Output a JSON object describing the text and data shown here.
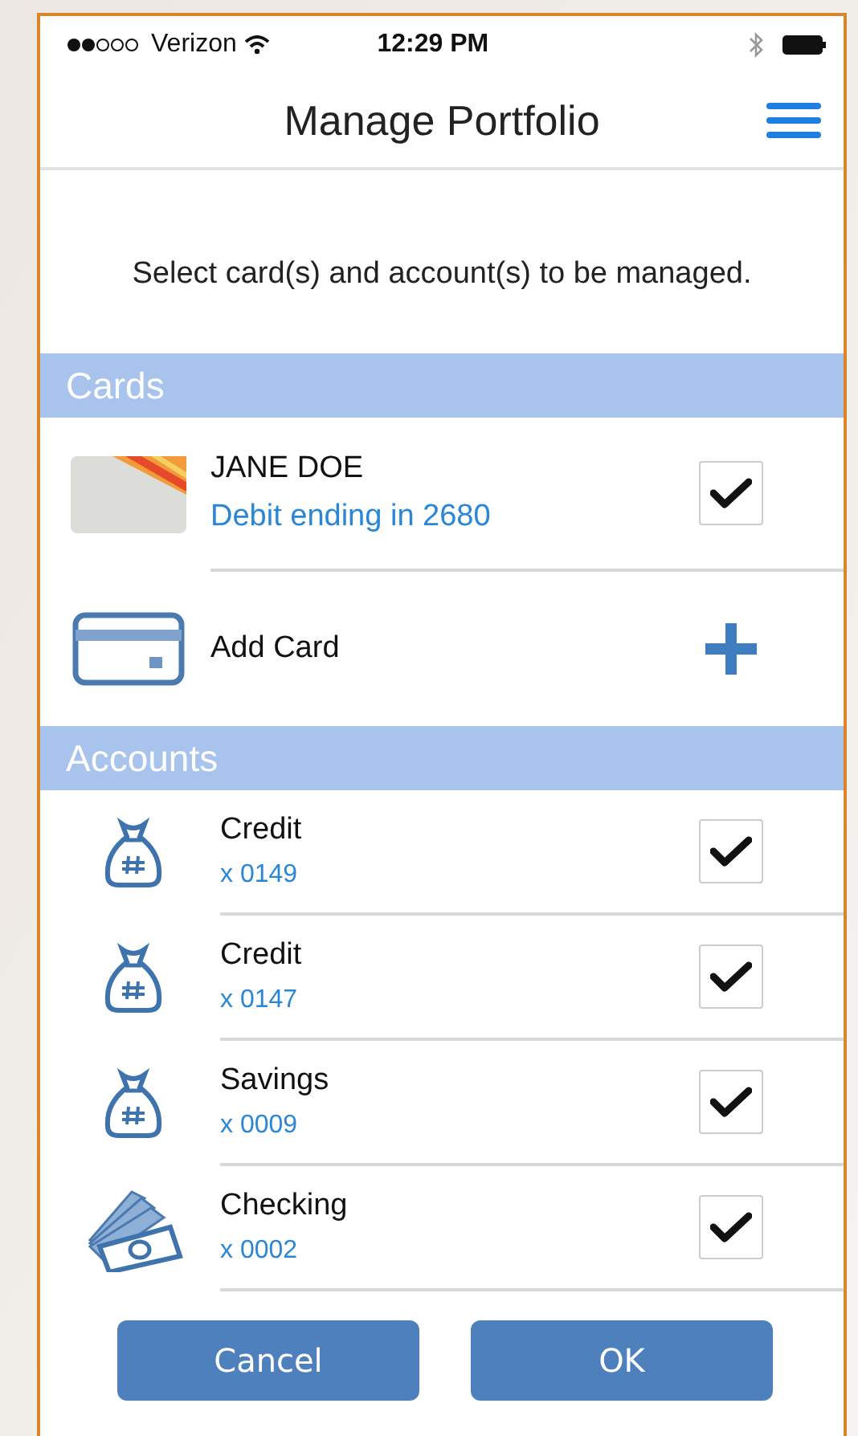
{
  "status_bar": {
    "carrier": "Verizon",
    "time": "12:29 PM"
  },
  "nav": {
    "title": "Manage Portfolio"
  },
  "instruction": "Select card(s) and account(s) to be managed.",
  "cards_section": {
    "title": "Cards",
    "cards": [
      {
        "name": "JANE DOE",
        "detail": "Debit ending in 2680",
        "checked": true
      }
    ],
    "add_label": "Add Card"
  },
  "accounts_section": {
    "title": "Accounts",
    "accounts": [
      {
        "kind": "bag",
        "name": "Credit",
        "number": "x 0149",
        "checked": true
      },
      {
        "kind": "bag",
        "name": "Credit",
        "number": "x 0147",
        "checked": true
      },
      {
        "kind": "bag",
        "name": "Savings",
        "number": "x 0009",
        "checked": true
      },
      {
        "kind": "cash",
        "name": "Checking",
        "number": "x 0002",
        "checked": true
      }
    ]
  },
  "buttons": [
    "Cancel",
    "OK"
  ]
}
